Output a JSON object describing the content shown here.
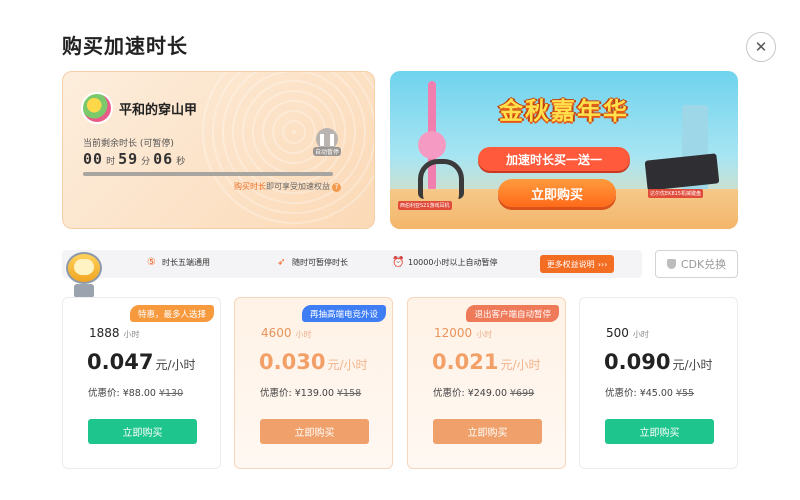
{
  "dialog": {
    "title": "购买加速时长",
    "close_glyph": "✕"
  },
  "account": {
    "username": "平和的穿山甲",
    "remaining_label": "当前剩余时长 (可暂停)",
    "hours": "00",
    "hours_unit": "时",
    "minutes": "59",
    "minutes_unit": "分",
    "seconds": "06",
    "seconds_unit": "秒",
    "pause_label": "自动暂停",
    "buy_link": "购买时长",
    "buy_hint": "即可享受加速权益",
    "help_glyph": "?"
  },
  "banner": {
    "title": "金秋嘉年华",
    "subtitle": "加速时长买一送一",
    "buy_label": "立即购买",
    "headset_caption": "西伯利亚S21游戏耳机",
    "keyboard_caption": "达尔优EK815机械键盘"
  },
  "benefits": {
    "items": [
      {
        "icon": "five-device-icon",
        "label": "时长五端通用"
      },
      {
        "icon": "rocket-icon",
        "label": "随时可暂停时长"
      },
      {
        "icon": "alarm-clock-icon",
        "label": "10000小时以上自动暂停"
      }
    ],
    "more_label": "更多权益说明",
    "more_arrows": "›››",
    "cdk_label": "CDK兑换"
  },
  "plans": [
    {
      "tag": "特惠，最多人选择",
      "hours": "1888",
      "hours_unit": "小时",
      "price": "0.047",
      "price_unit": "元/小时",
      "discount_label": "优惠价: ¥88.00",
      "original_price": "¥130",
      "buy_label": "立即购买",
      "tag_color": "#f79a3e",
      "button_color": "#1ec58c",
      "highlighted": false
    },
    {
      "tag": "再抽高端电竞外设",
      "hours": "4600",
      "hours_unit": "小时",
      "price": "0.030",
      "price_unit": "元/小时",
      "discount_label": "优惠价: ¥139.00",
      "original_price": "¥158",
      "buy_label": "立即购买",
      "tag_color": "#3f7df5",
      "button_color": "#f0a06a",
      "highlighted": true
    },
    {
      "tag": "退出客户端自动暂停",
      "hours": "12000",
      "hours_unit": "小时",
      "price": "0.021",
      "price_unit": "元/小时",
      "discount_label": "优惠价: ¥249.00",
      "original_price": "¥699",
      "buy_label": "立即购买",
      "tag_color": "#ef7a5a",
      "button_color": "#f0a06a",
      "highlighted": true
    },
    {
      "tag": "",
      "hours": "500",
      "hours_unit": "小时",
      "price": "0.090",
      "price_unit": "元/小时",
      "discount_label": "优惠价: ¥45.00",
      "original_price": "¥55",
      "buy_label": "立即购买",
      "tag_color": "",
      "button_color": "#1ec58c",
      "highlighted": false
    }
  ],
  "colors": {
    "accent_orange": "#f36d23",
    "buy_green": "#1ec58c",
    "buy_peach": "#f0a06a"
  }
}
